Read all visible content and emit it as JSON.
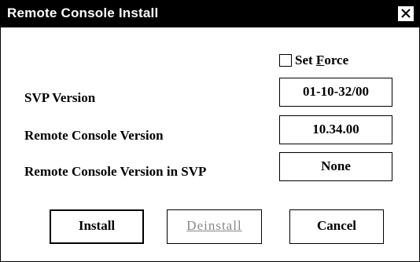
{
  "window": {
    "title": "Remote Console Install"
  },
  "set_force": {
    "label_prefix": "Set ",
    "label_accel": "F",
    "label_suffix": "orce",
    "checked": false
  },
  "fields": [
    {
      "label": "SVP Version",
      "value": "01-10-32/00"
    },
    {
      "label": "Remote Console Version",
      "value": "10.34.00"
    },
    {
      "label": "Remote Console Version in SVP",
      "value": "None"
    }
  ],
  "buttons": {
    "install": "Install",
    "deinstall": "Deinstall",
    "cancel": "Cancel"
  },
  "icons": {
    "close": "close-icon"
  }
}
